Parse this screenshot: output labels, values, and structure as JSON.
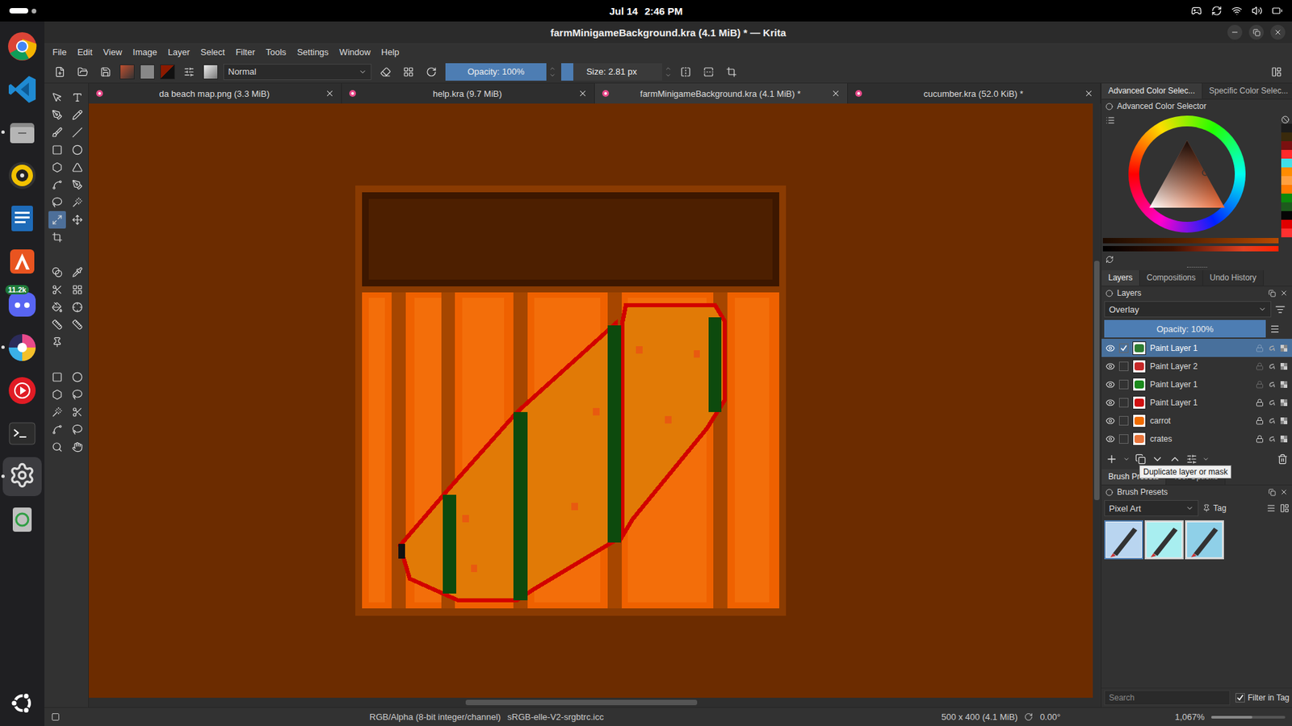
{
  "topbar": {
    "date": "Jul 14",
    "time": "2:46 PM"
  },
  "dock": [
    {
      "running": false
    },
    {
      "running": false
    },
    {
      "running": true
    },
    {
      "running": false
    },
    {
      "running": false
    },
    {
      "running": false
    },
    {
      "running": false,
      "badge": "11.2k"
    },
    {
      "running": true
    },
    {
      "running": false
    },
    {
      "running": false
    },
    {
      "running": true,
      "selected": true
    },
    {
      "running": false
    }
  ],
  "window": {
    "title": "farmMinigameBackground.kra (4.1 MiB) * — Krita"
  },
  "menu": [
    "File",
    "Edit",
    "View",
    "Image",
    "Layer",
    "Select",
    "Filter",
    "Tools",
    "Settings",
    "Window",
    "Help"
  ],
  "toolbar": {
    "blend_mode": "Normal",
    "opacity": {
      "label": "Opacity: 100%",
      "level": 1
    },
    "size": {
      "label": "Size: 2.81 px",
      "level": 0.12
    }
  },
  "document_tabs": [
    {
      "label": "da beach map.png (3.3 MiB)",
      "selected": false
    },
    {
      "label": "help.kra (9.7 MiB)",
      "selected": false
    },
    {
      "label": "farmMinigameBackground.kra (4.1 MiB) *",
      "selected": true
    },
    {
      "label": "cucumber.kra (52.0 KiB) *",
      "selected": false
    }
  ],
  "color_dock": {
    "tabs": [
      {
        "label": "Advanced Color Selec...",
        "selected": true
      },
      {
        "label": "Specific Color Selec...",
        "selected": false
      }
    ],
    "title": "Advanced Color Selector",
    "swatches": [
      {
        "color": "#1c1c1c"
      },
      {
        "color": "#3a2a0c"
      },
      {
        "color": "#7a1010"
      },
      {
        "color": "#ff2a2a"
      },
      {
        "color": "#40e0e8"
      },
      {
        "color": "#ff8c00"
      },
      {
        "color": "#ffa040"
      },
      {
        "color": "#ff7a00"
      },
      {
        "color": "#0c8a0c"
      },
      {
        "color": "#1d5a1d"
      },
      {
        "color": "#050505"
      },
      {
        "color": "#e00000"
      },
      {
        "color": "#ff3030"
      }
    ]
  },
  "layers_dock": {
    "tabs": [
      {
        "label": "Layers",
        "selected": true
      },
      {
        "label": "Compositions",
        "selected": false
      },
      {
        "label": "Undo History",
        "selected": false
      }
    ],
    "title": "Layers",
    "blend_mode": "Overlay",
    "opacity": {
      "label": "Opacity: 100%",
      "level": 1
    },
    "layers": [
      {
        "name": "Paint Layer 1",
        "visible": true,
        "checked": true,
        "selected": true,
        "locked": false,
        "color": "#2e7d32"
      },
      {
        "name": "Paint Layer 2",
        "visible": true,
        "checked": false,
        "selected": false,
        "locked": false,
        "color": "#c62828"
      },
      {
        "name": "Paint Layer 1",
        "visible": true,
        "checked": false,
        "selected": false,
        "locked": false,
        "color": "#1b8a1b"
      },
      {
        "name": "Paint Layer 1",
        "visible": true,
        "checked": false,
        "selected": false,
        "locked": true,
        "color": "#d01010"
      },
      {
        "name": "carrot",
        "visible": true,
        "checked": false,
        "selected": false,
        "locked": true,
        "color": "#ef6c00"
      },
      {
        "name": "crates",
        "visible": true,
        "checked": false,
        "selected": false,
        "locked": true,
        "color": "#e8743a"
      }
    ],
    "tooltip": "Duplicate layer or mask"
  },
  "brush_dock": {
    "tabs": [
      {
        "label": "Brush Presets",
        "selected": true
      },
      {
        "label": "Tool Options",
        "selected": false
      }
    ],
    "title": "Brush Presets",
    "tag": "Pixel Art",
    "tag_button": "Tag",
    "presets": [
      {
        "selected": true
      },
      {
        "selected": false
      },
      {
        "selected": false
      }
    ],
    "search_placeholder": "Search",
    "filter_label": "Filter in Tag",
    "filter_checked": true
  },
  "status_bar": {
    "color_model": "RGB/Alpha (8-bit integer/channel)",
    "profile": "sRGB-elle-V2-srgbtrc.icc",
    "image_size": "500 x 400 (4.1 MiB)",
    "rotation": "0.00°",
    "zoom": "1,067%",
    "zoom_level": 0.55
  }
}
